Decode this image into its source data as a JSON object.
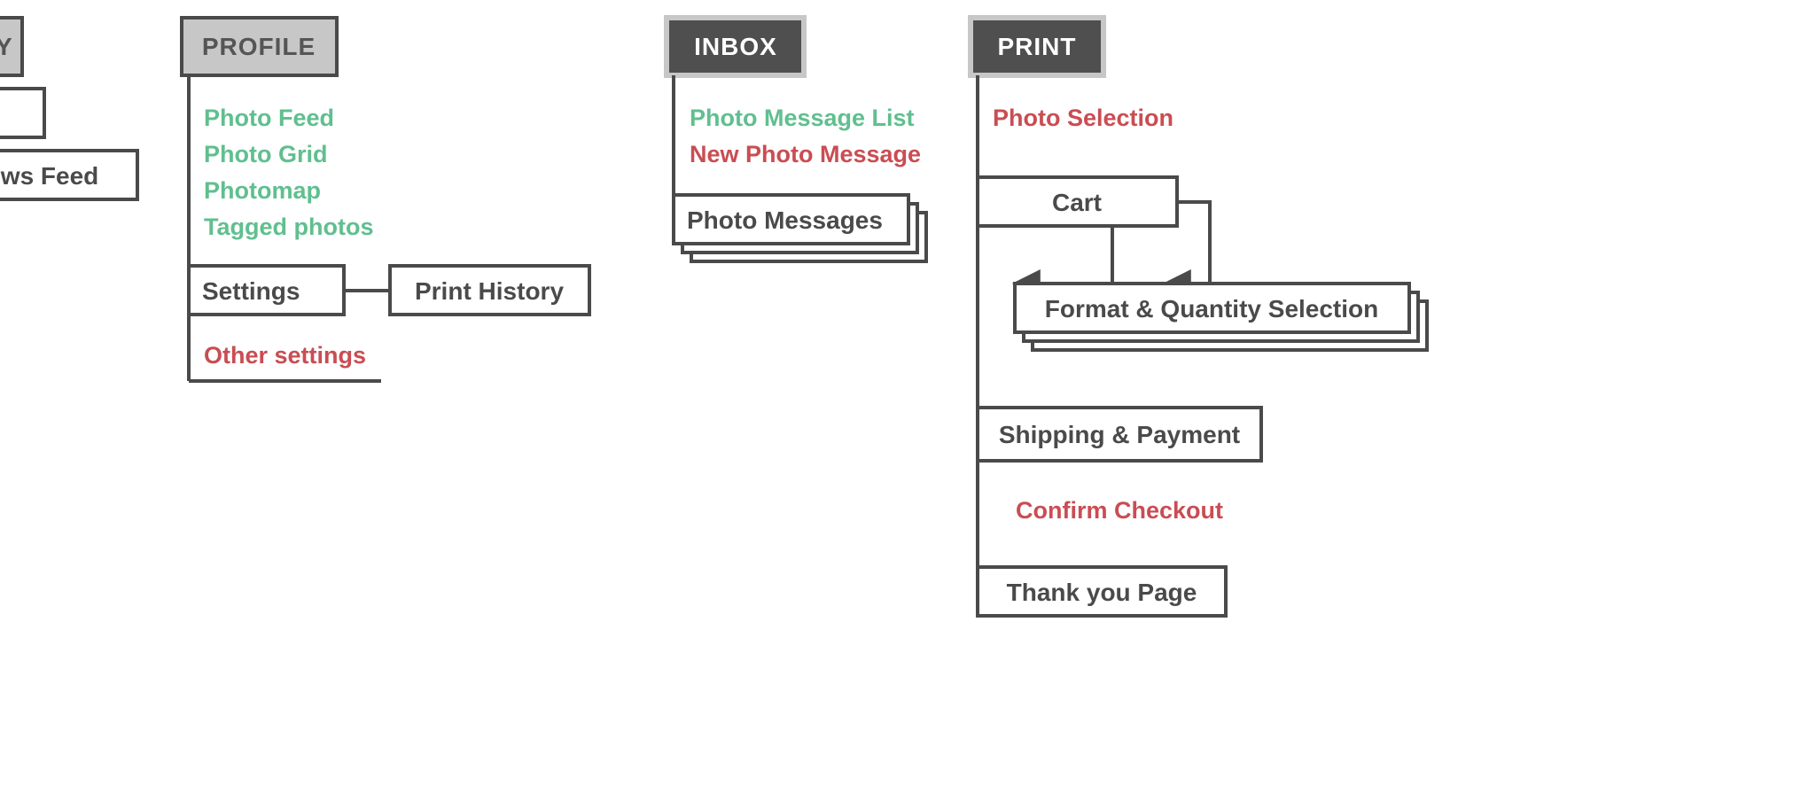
{
  "activity": {
    "title": "Y",
    "news_feed": "News Feed"
  },
  "profile": {
    "title": "PROFILE",
    "items": [
      "Photo Feed",
      "Photo Grid",
      "Photomap",
      "Tagged photos"
    ],
    "settings": "Settings",
    "print_history": "Print History",
    "other_settings": "Other settings"
  },
  "inbox": {
    "title": "INBOX",
    "photo_message_list": "Photo Message List",
    "new_photo_message": "New Photo Message",
    "photo_messages": "Photo Messages"
  },
  "print": {
    "title": "PRINT",
    "photo_selection": "Photo Selection",
    "cart": "Cart",
    "format_quantity": "Format & Quantity Selection",
    "shipping_payment": "Shipping & Payment",
    "confirm_checkout": "Confirm Checkout",
    "thank_you": "Thank you Page"
  }
}
